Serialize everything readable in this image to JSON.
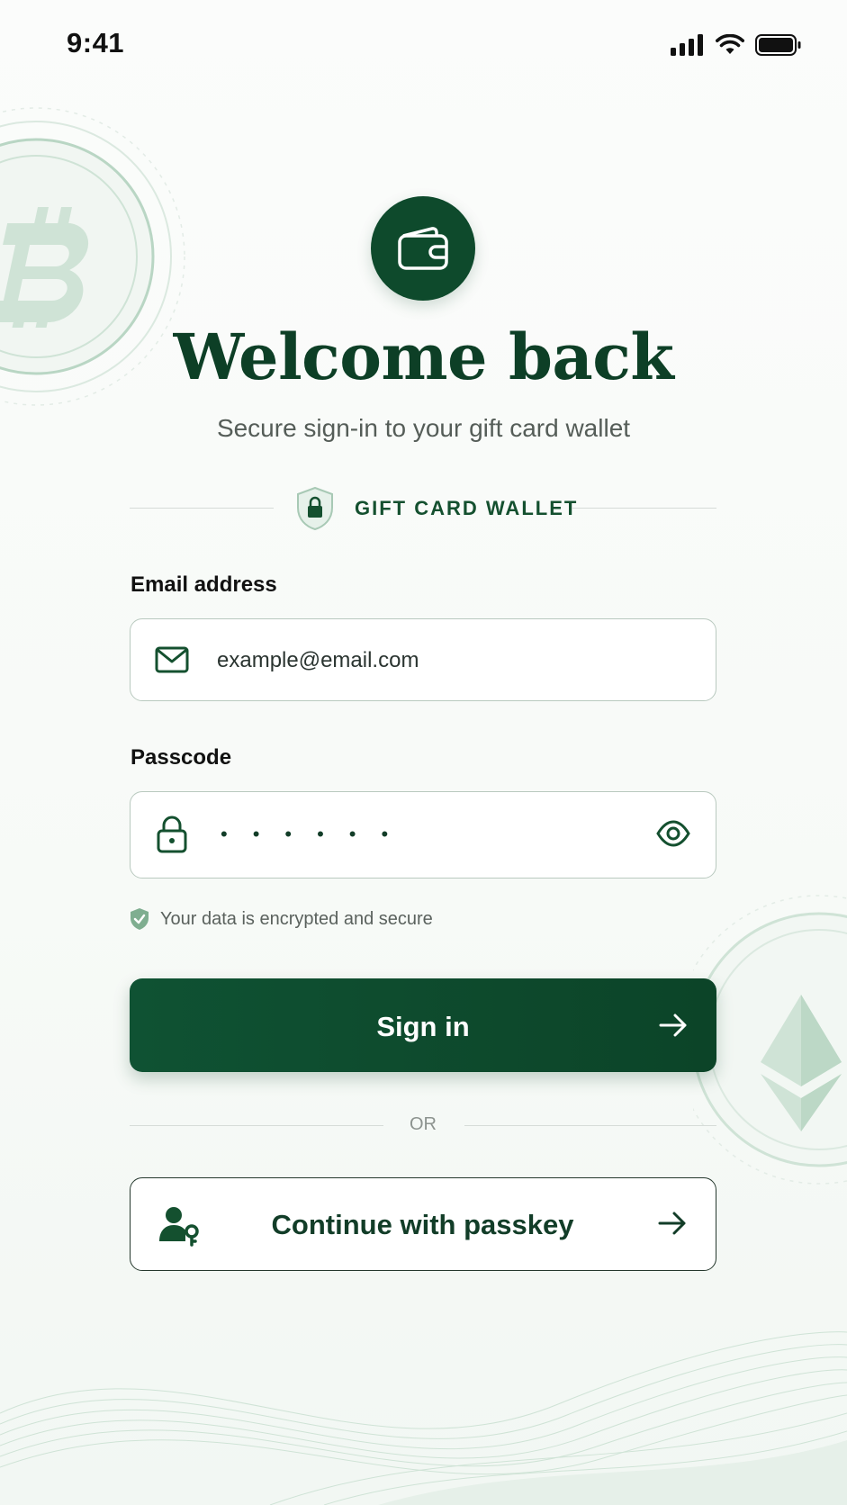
{
  "status_bar": {
    "time": "9:41",
    "icons": [
      "signal-icon",
      "wifi-icon",
      "battery-icon"
    ]
  },
  "header": {
    "logo_icon": "wallet-icon",
    "title": "Welcome back",
    "subtitle": "Secure sign-in to your gift card wallet",
    "brand_icon": "shield-lock-icon",
    "brand_label": "GIFT CARD WALLET"
  },
  "form": {
    "email": {
      "label": "Email address",
      "placeholder": "example@email.com",
      "icon": "mail-icon"
    },
    "passcode": {
      "label": "Passcode",
      "masked_value": "••••••",
      "icon": "lock-icon",
      "toggle_icon": "eye-icon"
    },
    "security_note": "Your data is encrypted and secure"
  },
  "actions": {
    "sign_in": "Sign in",
    "divider": "OR",
    "passkey": "Continue with passkey"
  },
  "colors": {
    "brand": "#0e4a2c",
    "accent_light": "#cfe3d6",
    "text": "#111111",
    "muted": "#5a615d"
  }
}
